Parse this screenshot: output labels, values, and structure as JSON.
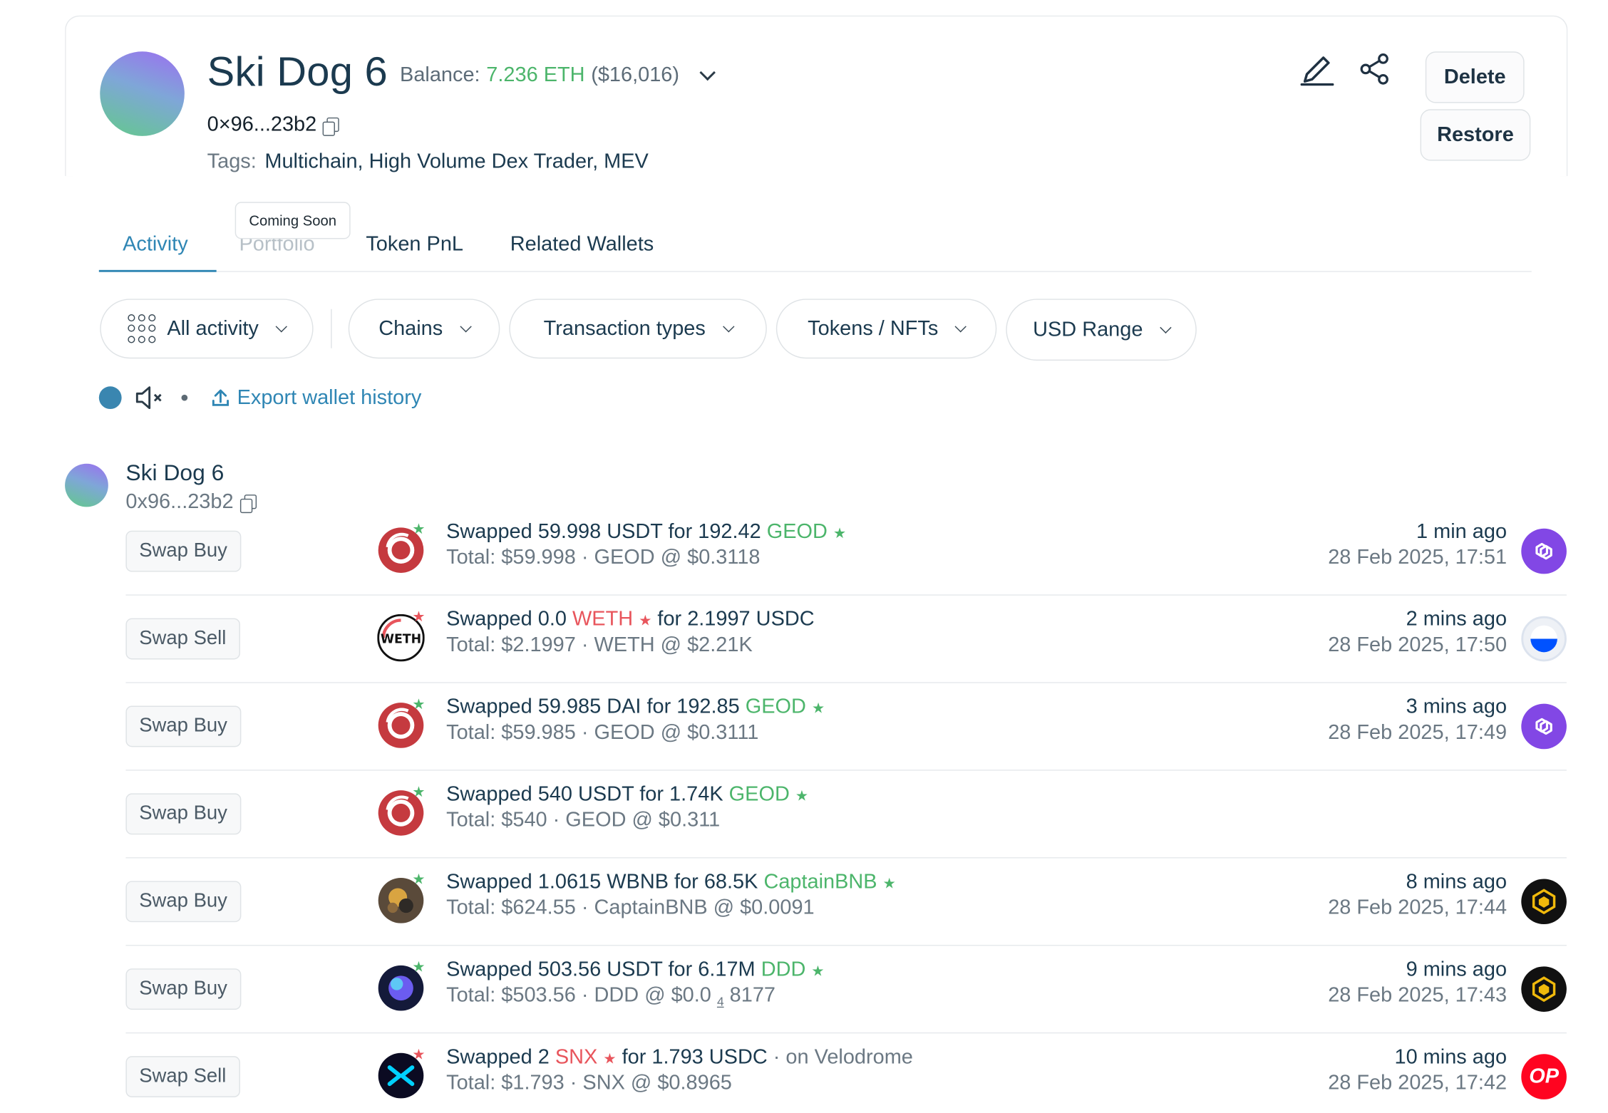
{
  "wallet": {
    "name": "Ski Dog 6",
    "balance_label": "Balance:",
    "balance_eth": "7.236 ETH",
    "balance_usd": "($16,016)",
    "address": "0×96...23b2",
    "tags_label": "Tags:",
    "tags": "Multichain, High Volume Dex Trader, MEV"
  },
  "actions": {
    "delete": "Delete",
    "restore": "Restore"
  },
  "tabs": [
    {
      "label": "Activity",
      "active": true
    },
    {
      "label": "Portfolio",
      "disabled": true
    },
    {
      "label": "Token PnL"
    },
    {
      "label": "Related Wallets"
    }
  ],
  "tooltip": "Coming Soon",
  "filters": {
    "all_activity": "All activity",
    "chains": "Chains",
    "tx_types": "Transaction types",
    "tokens": "Tokens / NFTs",
    "usd_range": "USD Range"
  },
  "export_label": "Export wallet history",
  "feed_wallet": {
    "name": "Ski Dog 6",
    "address": "0x96...23b2"
  },
  "transactions": [
    {
      "type": "Swap Buy",
      "pre": "Swapped 59.998 USDT for 192.42 ",
      "token": "GEOD",
      "post": "",
      "total": "Total: $59.998 · GEOD @ $0.3118",
      "time": "1 min ago",
      "date": "28 Feb 2025, 17:51",
      "chain": "polygon"
    },
    {
      "type": "Swap Sell",
      "pre": "Swapped 0.0 ",
      "token": "WETH",
      "post": " for 2.1997 USDC",
      "total": "Total: $2.1997 · WETH @ $2.21K",
      "time": "2 mins ago",
      "date": "28 Feb 2025, 17:50",
      "chain": "base"
    },
    {
      "type": "Swap Buy",
      "pre": "Swapped 59.985 DAI for 192.85 ",
      "token": "GEOD",
      "post": "",
      "total": "Total: $59.985 · GEOD @ $0.3111",
      "time": "3 mins ago",
      "date": "28 Feb 2025, 17:49",
      "chain": "polygon"
    },
    {
      "type": "Swap Buy",
      "pre": "Swapped 540 USDT for 1.74K ",
      "token": "GEOD",
      "post": "",
      "total": "Total: $540 · GEOD @ $0.311",
      "time": "",
      "date": "",
      "chain": ""
    },
    {
      "type": "Swap Buy",
      "pre": "Swapped 1.0615 WBNB for 68.5K ",
      "token": "CaptainBNB",
      "post": "",
      "total": "Total: $624.55 · CaptainBNB @ $0.0091",
      "time": "8 mins ago",
      "date": "28 Feb 2025, 17:44",
      "chain": "bnb"
    },
    {
      "type": "Swap Buy",
      "pre": "Swapped 503.56 USDT for 6.17M ",
      "token": "DDD",
      "post": "",
      "total_pre": "Total: $503.56 · DDD @ $0.0",
      "total_sub": "4",
      "total_post": "8177",
      "time": "9 mins ago",
      "date": "28 Feb 2025, 17:43",
      "chain": "bnb"
    },
    {
      "type": "Swap Sell",
      "pre": "Swapped 2 ",
      "token": "SNX",
      "post": " for 1.793 USDC",
      "venue": " · on Velodrome",
      "total": "Total: $1.793 · SNX @ $0.8965",
      "time": "10 mins ago",
      "date": "28 Feb 2025, 17:42",
      "chain": "optimism",
      "chain_label": "OP"
    }
  ],
  "colors": {
    "accent": "#2f86b4",
    "positive": "#4cb56b",
    "negative": "#e8555c",
    "text": "#1b3a4f"
  }
}
